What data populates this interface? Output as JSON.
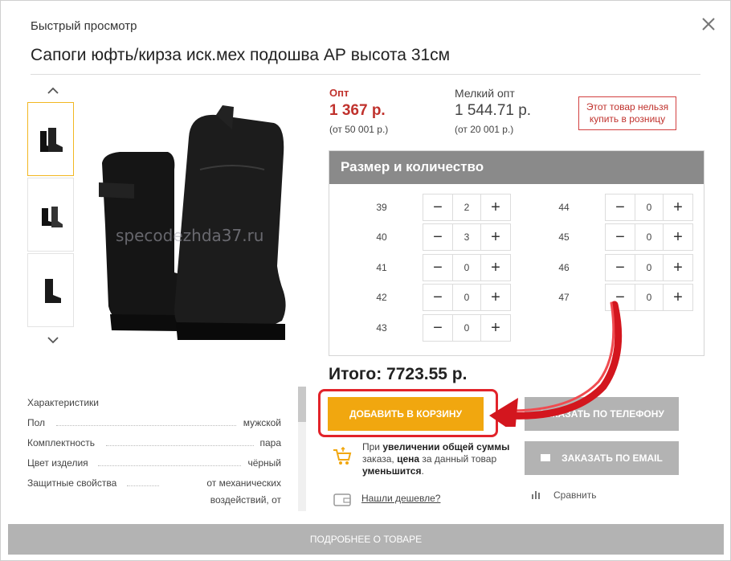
{
  "header": {
    "label": "Быстрый просмотр",
    "close_icon": "close-icon"
  },
  "product": {
    "title": "Сапоги юфть/кирза иск.мех подошва АР высота 31см",
    "watermark": "specodezhda37.ru"
  },
  "gallery": {
    "thumbnails": [
      "thumb-1",
      "thumb-2",
      "thumb-3"
    ],
    "active_index": 0
  },
  "prices": {
    "wholesale": {
      "label": "Опт",
      "price": "1 367 р.",
      "note": "(от 50 001 р.)"
    },
    "small_wholesale": {
      "label": "Мелкий опт",
      "price": "1 544.71 р.",
      "note": "(от 20 001 р.)"
    },
    "retail_note": "Этот товар нельзя купить в розницу"
  },
  "sizes": {
    "title": "Размер и количество",
    "left": [
      {
        "size": "39",
        "qty": "2"
      },
      {
        "size": "40",
        "qty": "3"
      },
      {
        "size": "41",
        "qty": "0"
      },
      {
        "size": "42",
        "qty": "0"
      },
      {
        "size": "43",
        "qty": "0"
      }
    ],
    "right": [
      {
        "size": "44",
        "qty": "0"
      },
      {
        "size": "45",
        "qty": "0"
      },
      {
        "size": "46",
        "qty": "0"
      },
      {
        "size": "47",
        "qty": "0"
      }
    ],
    "minus": "−",
    "plus": "+"
  },
  "total": "Итого: 7723.55 р.",
  "characteristics": {
    "title": "Характеристики",
    "rows": [
      {
        "key": "Пол",
        "value": "мужской"
      },
      {
        "key": "Комплектность",
        "value": "пара"
      },
      {
        "key": "Цвет изделия",
        "value": "чёрный"
      },
      {
        "key": "Защитные свойства",
        "value": "от механических"
      },
      {
        "key": "",
        "value": "воздействий, от"
      }
    ]
  },
  "actions": {
    "add_to_cart": "ДОБАВИТЬ В КОРЗИНУ",
    "order_phone": "ЗАКАЗАТЬ ПО ТЕЛЕФОНУ",
    "order_email": "ЗАКАЗАТЬ ПО EMAIL",
    "promo_1": "При ",
    "promo_2": "увеличении общей суммы",
    "promo_3": " заказа, ",
    "promo_4": "цена",
    "promo_5": " за данный товар ",
    "promo_6": "уменьшится",
    "promo_7": ".",
    "found_cheaper": "Нашли дешевле?",
    "compare": "Сравнить",
    "more": "ПОДРОБНЕЕ О ТОВАРЕ"
  },
  "colors": {
    "accent": "#f1a70f",
    "price_red": "#c0322d",
    "grey_button": "#b3b3b3",
    "highlight_red": "#e2232a"
  }
}
